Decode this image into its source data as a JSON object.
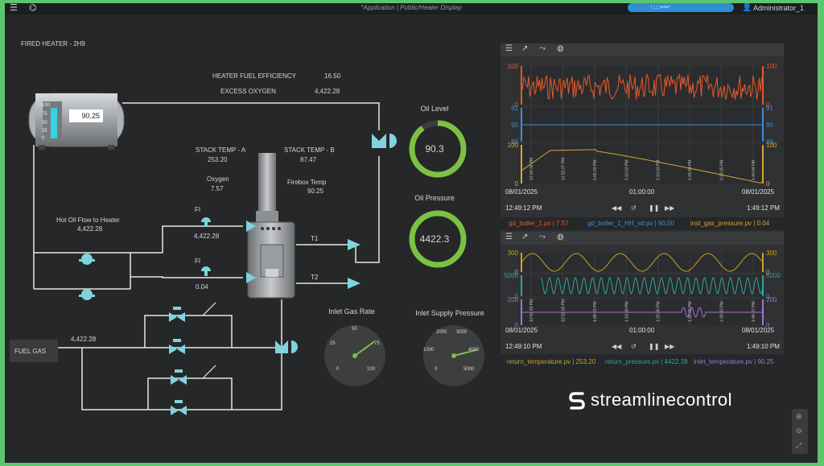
{
  "topbar": {
    "breadcrumb": "*Application | Public/Heater Display",
    "user": "Administrator_1",
    "blue_tab": "↑↓↓:↩↩"
  },
  "title": "FIRED HEATER - 2H9",
  "tank": {
    "level_value": "90.25",
    "scale": [
      "100",
      "75",
      "50",
      "25",
      "0"
    ],
    "level_fraction": 0.9
  },
  "readings": {
    "fuel_eff_label": "HEATER FUEL EFFICIENCY",
    "fuel_eff_value": "16.50",
    "excess_o2_label": "EXCESS OXYGEN",
    "excess_o2_value": "4,422.28",
    "stack_a_label": "STACK TEMP - A",
    "stack_a_value": "253.20",
    "stack_b_label": "STACK TEMP - B",
    "stack_b_value": "87.47",
    "oxygen_label": "Oxygen",
    "oxygen_value": "7.57",
    "firebox_label": "Firebox Temp",
    "firebox_value": "90.25",
    "hot_oil_label": "Hot Oil Flow to Heater",
    "hot_oil_value": "4,422.28",
    "fi1_label": "FI",
    "fi1_value": "4,422.28",
    "fi2_label": "FI",
    "fi2_value": "0.04",
    "t1_label": "T1",
    "t2_label": "T2",
    "fuel_gas_label": "FUEL GAS",
    "fuel_gas_value": "4,422.28"
  },
  "gauges": {
    "oil_level": {
      "label": "Oil Level",
      "value": "90.3",
      "fraction": 0.9
    },
    "oil_pressure": {
      "label": "Oil Pressure",
      "value": "4422.3",
      "fraction": 1.0
    },
    "inlet_gas_rate": {
      "label": "Inlet Gas Rate",
      "ticks": [
        "0",
        "25",
        "50",
        "75",
        "100"
      ],
      "value": 70
    },
    "inlet_supply_pressure": {
      "label": "Inlet Supply Pressure",
      "ticks": [
        "0",
        "1000",
        "2000",
        "3000",
        "4000",
        "5000"
      ],
      "value": 3900
    }
  },
  "colors": {
    "accent": "#7fd3dd",
    "gauge_green": "#7cc242",
    "orange": "#e35a2c",
    "blue": "#3a8fd8",
    "gold": "#d9a430",
    "teal": "#2ea59a",
    "purple": "#a970d6",
    "yellow_gold": "#c9a227"
  },
  "trend1": {
    "axes": {
      "left1": [
        "100",
        "0"
      ],
      "left2": [
        "91",
        "90",
        "89"
      ],
      "left3": [
        "100",
        "0"
      ]
    },
    "times": [
      "12:50:19 PM",
      "12:52:27 PM",
      "1:05:19 PM",
      "1:12:03 PM",
      "1:19:33 PM",
      "1:26:33 PM",
      "1:33:45 PM",
      "1:40:44 PM"
    ],
    "start_date": "08/01/2025",
    "duration": "01:00:00",
    "end_date": "08/01/2025",
    "start_time": "12:49:12 PM",
    "end_time": "1:49:12 PM",
    "legend": [
      {
        "text": "gd_boiler_1.pv | 7.57",
        "color": "#e35a2c"
      },
      {
        "text": "gd_boiler_1_HH_sd.pv | 90.00",
        "color": "#3a8fd8"
      },
      {
        "text": "inst_gas_pressure.pv | 0.04",
        "color": "#d9a430"
      }
    ]
  },
  "trend2": {
    "axes": {
      "left1": [
        "300",
        "0"
      ],
      "left2": [
        "5000",
        "0"
      ],
      "left3": [
        "200",
        "0"
      ]
    },
    "times": [
      "12:50:19 PM",
      "12:59:00 PM",
      "1:08:23 PM",
      "1:18:36 PM",
      "1:25:05 PM",
      "1:32:29 PM",
      "1:39:43 PM",
      "1:46:27 PM"
    ],
    "start_date": "08/01/2025",
    "duration": "01:00:00",
    "end_date": "08/01/2025",
    "start_time": "12:49:10 PM",
    "end_time": "1:49:10 PM",
    "legend": [
      {
        "text": "return_temperature.pv | 253.20",
        "color": "#c9a227"
      },
      {
        "text": "return_pressure.pv | 4422.28",
        "color": "#2ea59a"
      },
      {
        "text": "inlet_temperature.pv | 90.25",
        "color": "#a970d6"
      }
    ]
  },
  "brand": "streamlinecontrol"
}
